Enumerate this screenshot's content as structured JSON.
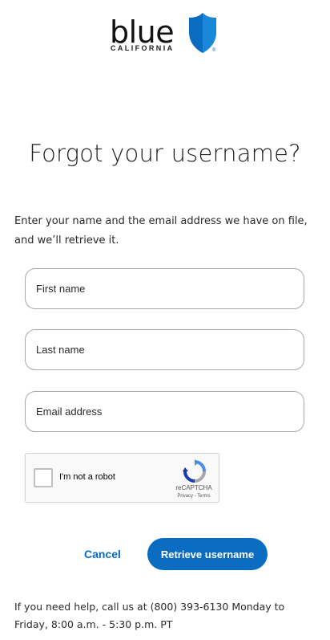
{
  "brand": {
    "wordmark": "blue",
    "sub": "CALIFORNIA",
    "reg": "®",
    "accent_color": "#0b6dc1"
  },
  "page": {
    "title": "Forgot your username?",
    "intro": "Enter your name and the email address we have on file, and we’ll retrieve it."
  },
  "form": {
    "first_name_placeholder": "First name",
    "last_name_placeholder": "Last name",
    "email_placeholder": "Email address"
  },
  "captcha": {
    "label": "I'm not a robot",
    "brand": "reCAPTCHA",
    "links": "Privacy - Terms"
  },
  "actions": {
    "cancel_label": "Cancel",
    "retrieve_label": "Retrieve username"
  },
  "help": {
    "text": "If you need help, call us at (800) 393-6130 Monday to Friday, 8:00 a.m. - 5:30 p.m. PT"
  }
}
